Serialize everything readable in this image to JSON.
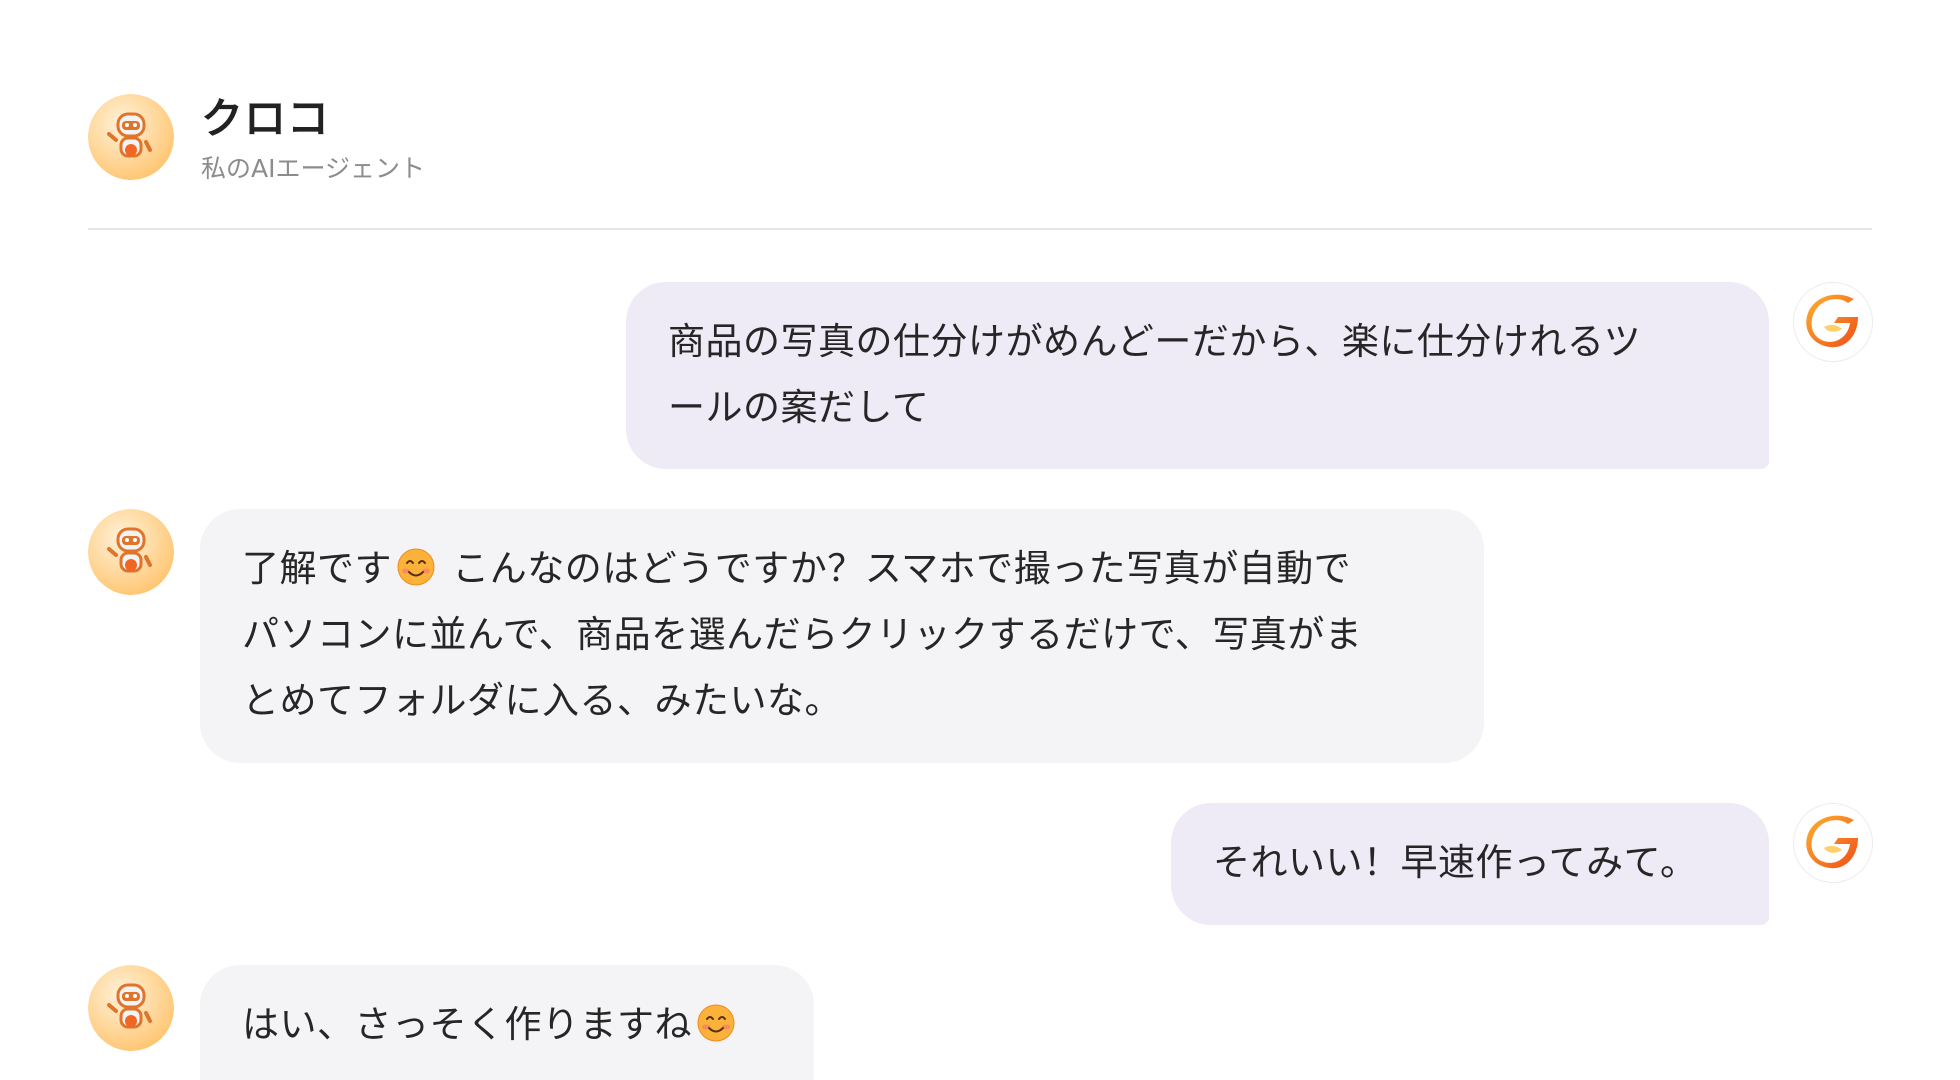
{
  "header": {
    "title": "クロコ",
    "subtitle": "私のAIエージェント",
    "avatar_icon": "robot-mascot-icon"
  },
  "user": {
    "avatar_icon": "g-logo-icon"
  },
  "colors": {
    "user_bubble": "#eeeaf6",
    "agent_bubble": "#f4f4f6",
    "accent_orange": "#f08a1c"
  },
  "messages": [
    {
      "role": "user",
      "line1": "商品の写真の仕分けがめんどーだから、楽に仕分けれるツ",
      "line2": "ールの案だして"
    },
    {
      "role": "agent",
      "part1": "了解です",
      "emoji": "smiling-face-icon",
      "part2": " こんなのはどうですか？スマホで撮った写真が自動で",
      "line2": "パソコンに並んで、商品を選んだらクリックするだけで、写真がま",
      "line3": "とめてフォルダに入る、みたいな。"
    },
    {
      "role": "user",
      "line1": "それいい！早速作ってみて。"
    },
    {
      "role": "agent",
      "part1": "はい、さっそく作りますね",
      "emoji": "smiling-face-icon"
    }
  ]
}
